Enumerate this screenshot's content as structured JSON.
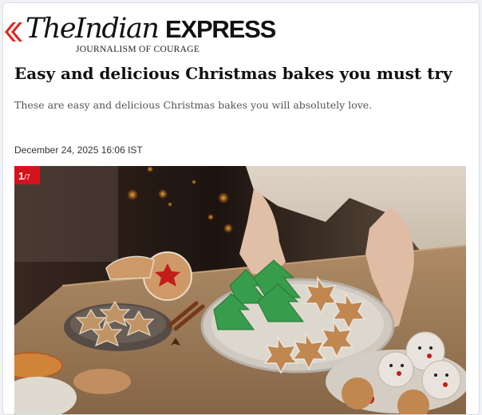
{
  "brand": {
    "word_the": "The",
    "word_indian": "Indian",
    "word_express": "EXPRESS",
    "tagline": "JOURNALISM OF COURAGE",
    "logo_icon": "ie-stripes-icon",
    "accent_color": "#e0251f"
  },
  "article": {
    "headline": "Easy and delicious Christmas bakes you must try",
    "subhead": "These are easy and delicious Christmas bakes you will absolutely love.",
    "dateline": "December 24, 2025 16:06 IST"
  },
  "gallery": {
    "current": "1",
    "separator": "/",
    "total": "7",
    "badge_color": "#d5131c"
  }
}
